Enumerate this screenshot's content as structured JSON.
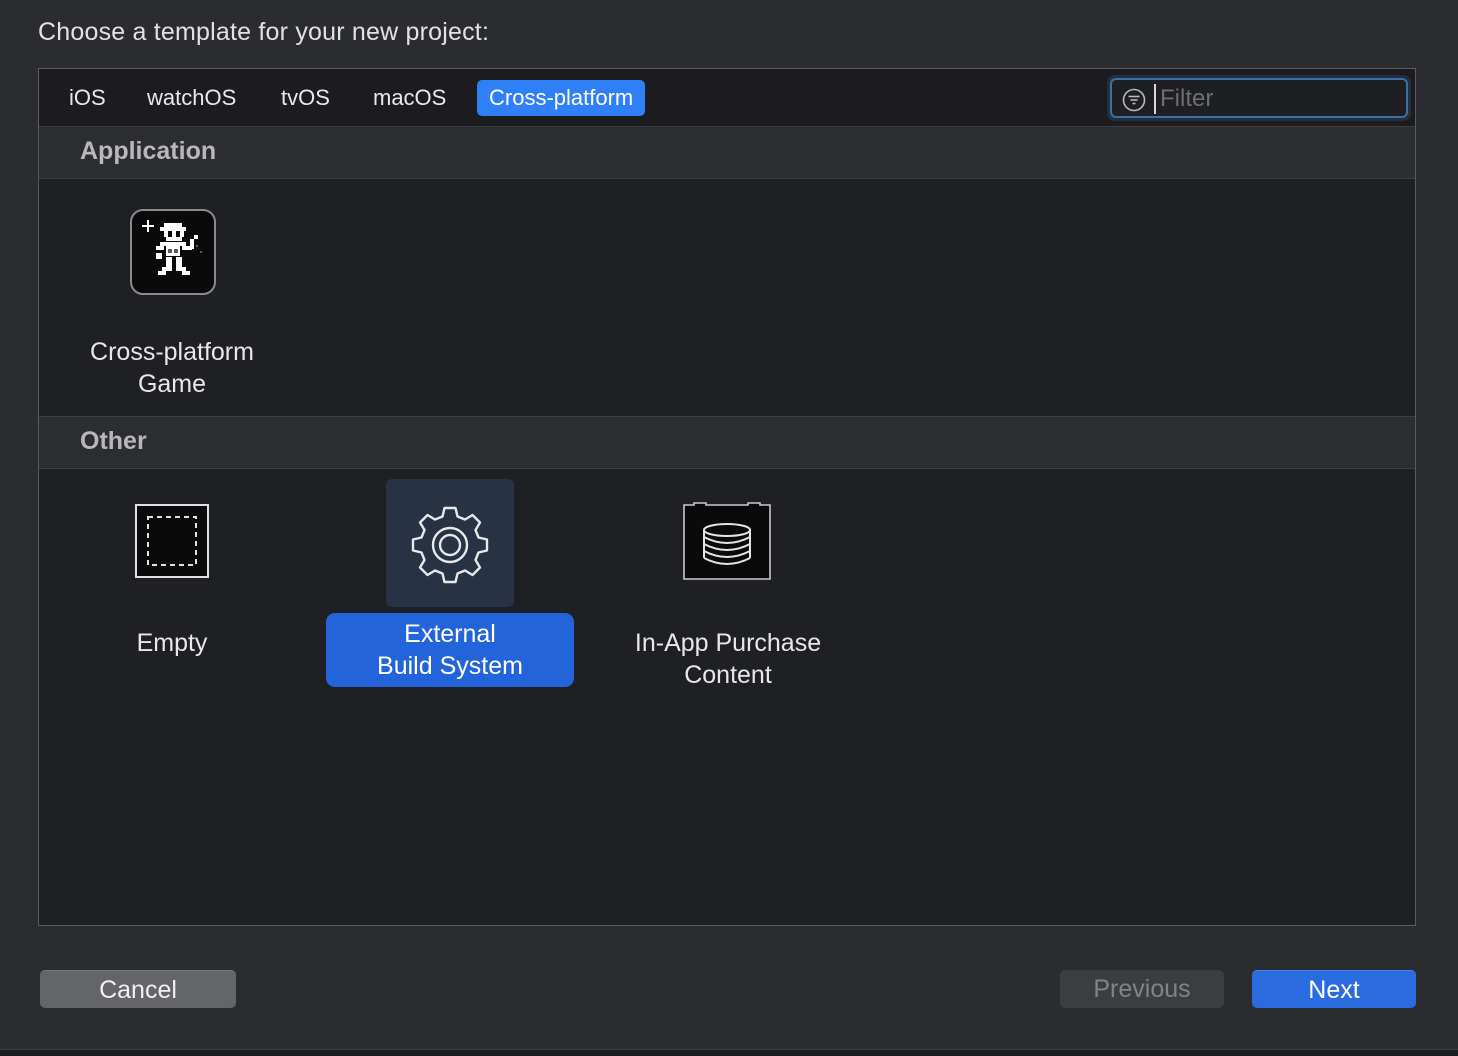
{
  "prompt": "Choose a template for your new project:",
  "tabs": [
    {
      "label": "iOS",
      "active": false
    },
    {
      "label": "watchOS",
      "active": false
    },
    {
      "label": "tvOS",
      "active": false
    },
    {
      "label": "macOS",
      "active": false
    },
    {
      "label": "Cross-platform",
      "active": true
    }
  ],
  "filter": {
    "placeholder": "Filter",
    "value": ""
  },
  "sections": [
    {
      "title": "Application",
      "templates": [
        {
          "label_line1": "Cross-platform",
          "label_line2": "Game",
          "icon": "game-sprite-icon",
          "selected": false
        }
      ]
    },
    {
      "title": "Other",
      "templates": [
        {
          "label_line1": "Empty",
          "label_line2": "",
          "icon": "empty-frame-icon",
          "selected": false
        },
        {
          "label_line1": "External",
          "label_line2": "Build System",
          "icon": "gear-icon",
          "selected": true
        },
        {
          "label_line1": "In-App Purchase",
          "label_line2": "Content",
          "icon": "in-app-purchase-icon",
          "selected": false
        }
      ]
    }
  ],
  "buttons": {
    "cancel": "Cancel",
    "previous": "Previous",
    "next": "Next"
  },
  "colors": {
    "accent": "#2f7ff6",
    "selection": "#2464db",
    "background": "#2b2c30"
  }
}
